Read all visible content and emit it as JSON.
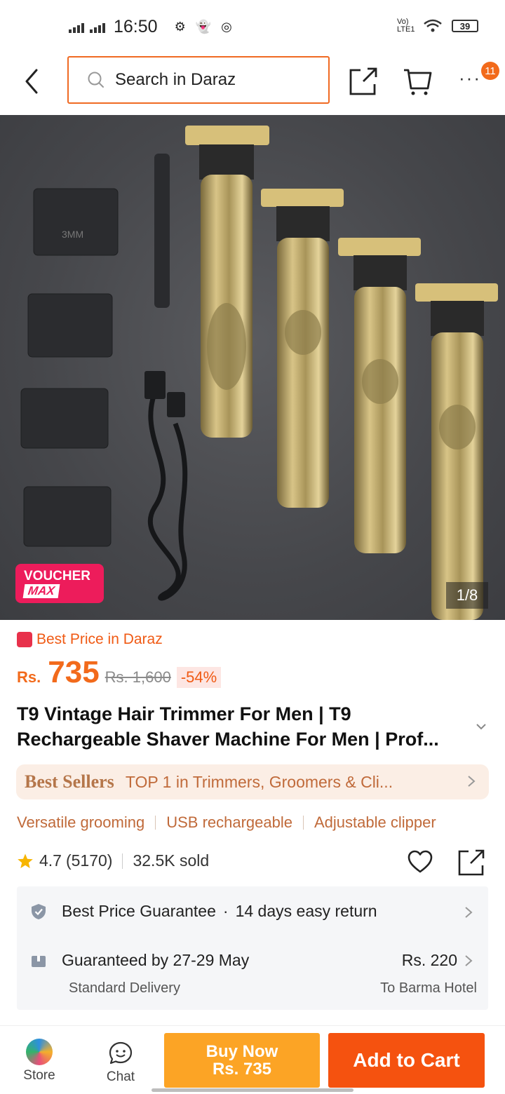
{
  "status_bar": {
    "time": "16:50",
    "network_label": "Vo) LTE1",
    "battery": "39"
  },
  "header": {
    "search_placeholder": "Search in Daraz",
    "cart_badge": "11"
  },
  "gallery": {
    "counter": "1/8",
    "voucher_line1": "VOUCHER",
    "voucher_line2": "MAX"
  },
  "price": {
    "best_price_label": "Best Price in Daraz",
    "currency": "Rs.",
    "current": "735",
    "original": "Rs. 1,600",
    "discount": "-54%"
  },
  "product": {
    "title_line1": "T9 Vintage Hair Trimmer For Men | T9",
    "title_line2": "Rechargeable Shaver Machine For Men | Prof..."
  },
  "best_sellers": {
    "label": "Best Sellers",
    "text": "TOP 1 in Trimmers, Groomers & Cli..."
  },
  "features": [
    "Versatile grooming",
    "USB rechargeable",
    "Adjustable clipper"
  ],
  "rating": {
    "score": "4.7",
    "count": "(5170)",
    "sold": "32.5K sold"
  },
  "service": {
    "guarantee": "Best Price Guarantee",
    "returns": "14 days easy return",
    "delivery": "Guaranteed by 27-29 May",
    "delivery_fee": "Rs. 220",
    "delivery_type": "Standard Delivery",
    "delivery_to": "To Barma Hotel"
  },
  "bottom_bar": {
    "store_label": "Store",
    "chat_label": "Chat",
    "buy_now_line1": "Buy Now",
    "buy_now_line2": "Rs. 735",
    "add_to_cart": "Add to Cart"
  },
  "colors": {
    "accent": "#f26a1b",
    "buy_now": "#fca425",
    "add_to_cart": "#f5520f",
    "voucher": "#ed1c5b"
  }
}
